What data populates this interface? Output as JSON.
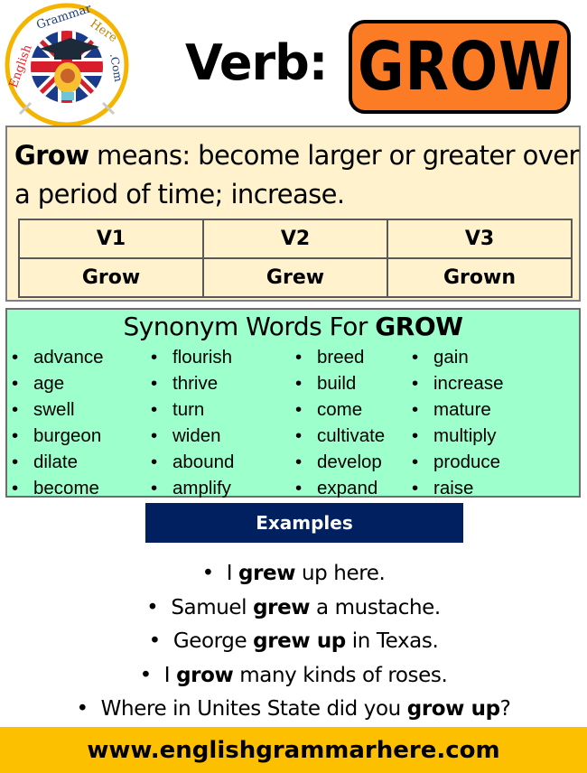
{
  "logo": {
    "text_top": "EnglishGrammarHere.Com",
    "parts": [
      "English",
      "Grammar",
      "Here",
      ".Com"
    ],
    "colors": {
      "ring": "#f5b400",
      "english": "#e3262c",
      "grammar": "#1d3d7a",
      "here": "#b8860b"
    }
  },
  "header": {
    "verb_label": "Verb:",
    "verb": "GROW",
    "badge_color": "#fb7c24"
  },
  "meaning": {
    "word": "Grow",
    "definition": " means: become larger or greater over a period of time; increase.",
    "box_color": "#fff2cc"
  },
  "forms": {
    "headers": [
      "V1",
      "V2",
      "V3"
    ],
    "values": [
      "Grow",
      "Grew",
      "Grown"
    ]
  },
  "synonyms": {
    "title_prefix": "Synonym Words For ",
    "title_word": "GROW",
    "box_color": "#9dffcc",
    "columns": [
      [
        "advance",
        "age",
        "swell",
        "burgeon",
        "dilate",
        "become"
      ],
      [
        "flourish",
        "thrive",
        "turn",
        "widen",
        "abound",
        "amplify"
      ],
      [
        "breed",
        "build",
        "come",
        "cultivate",
        "develop",
        "expand"
      ],
      [
        "gain",
        "increase",
        "mature",
        "multiply",
        "produce",
        "raise"
      ]
    ]
  },
  "examples": {
    "header": "Examples",
    "header_color": "#002060",
    "sentences": [
      {
        "before": "I ",
        "bold": "grew",
        "after": " up here."
      },
      {
        "before": "Samuel ",
        "bold": "grew",
        "after": " a mustache."
      },
      {
        "before": "George ",
        "bold": "grew up",
        "after": " in Texas."
      },
      {
        "before": "I ",
        "bold": "grow",
        "after": " many kinds of roses."
      },
      {
        "before": "Where in Unites State did you ",
        "bold": "grow up",
        "after": "?"
      }
    ]
  },
  "footer": {
    "url": "www.englishgrammarhere.com",
    "color": "#fdc000"
  }
}
